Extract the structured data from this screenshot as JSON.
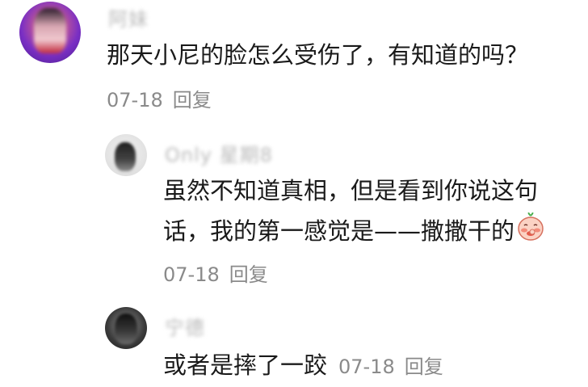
{
  "comments": [
    {
      "username": "阿妹",
      "text": "那天小尼的脸怎么受伤了，有知道的吗？",
      "date": "07-18",
      "reply_label": "回复"
    },
    {
      "username": "Only 星期8",
      "text_line1": "虽然不知道真相，但是看到你说这句",
      "text_line2": "话，我的第一感觉是——撒撒干的",
      "emoji": "blush-emoji",
      "date": "07-18",
      "reply_label": "回复"
    },
    {
      "username": "宁德",
      "text": "或者是摔了一跤",
      "date": "07-18",
      "reply_label": "回复"
    }
  ]
}
